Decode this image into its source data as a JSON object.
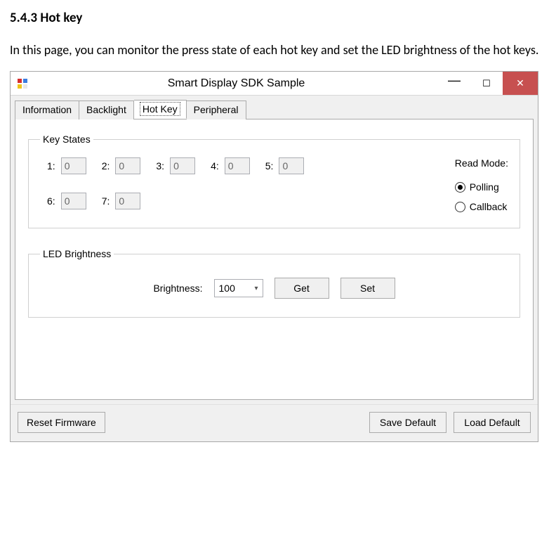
{
  "doc": {
    "heading": "5.4.3 Hot key",
    "intro": "In this page, you can monitor the press state of each hot key and set the LED brightness of the hot keys."
  },
  "window": {
    "title": "Smart Display SDK Sample"
  },
  "tabs": [
    {
      "label": "Information"
    },
    {
      "label": "Backlight"
    },
    {
      "label": "Hot Key"
    },
    {
      "label": "Peripheral"
    }
  ],
  "keyStates": {
    "legend": "Key States",
    "keys": [
      {
        "label": "1:",
        "value": "0"
      },
      {
        "label": "2:",
        "value": "0"
      },
      {
        "label": "3:",
        "value": "0"
      },
      {
        "label": "4:",
        "value": "0"
      },
      {
        "label": "5:",
        "value": "0"
      },
      {
        "label": "6:",
        "value": "0"
      },
      {
        "label": "7:",
        "value": "0"
      }
    ],
    "readMode": {
      "title": "Read Mode:",
      "polling": "Polling",
      "callback": "Callback",
      "selected": "polling"
    }
  },
  "ledBrightness": {
    "legend": "LED Brightness",
    "label": "Brightness:",
    "value": "100",
    "getLabel": "Get",
    "setLabel": "Set"
  },
  "buttons": {
    "resetFirmware": "Reset Firmware",
    "saveDefault": "Save Default",
    "loadDefault": "Load Default"
  }
}
